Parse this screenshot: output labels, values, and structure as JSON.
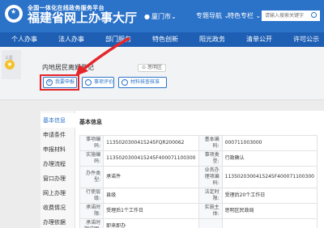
{
  "header": {
    "subtitle": "全国一体化在线政务服务平台",
    "title": "福建省网上办事大厅",
    "city": "厦门市",
    "links": [
      "专题导航",
      "特色专栏"
    ],
    "search_placeholder": "请输入搜索关键字",
    "brand_color": "#2b72c9"
  },
  "nav": {
    "items": [
      "个人办事",
      "法人办事",
      "部门服务",
      "特色创新",
      "阳光政务",
      "清单公开",
      "许可公示"
    ]
  },
  "service": {
    "badge": "三星",
    "title": "内地居民离婚登记",
    "location_tag": "思明区",
    "buttons": [
      "我要申报",
      "事项评价",
      "材料核查核准"
    ]
  },
  "sidebar": {
    "items": [
      "基本信息",
      "申请条件",
      "申报材料",
      "办理流程",
      "窗口办理",
      "网上办理",
      "收费情况",
      "办理依据"
    ],
    "active_index": 0
  },
  "basic_info": {
    "section_title": "基本信息",
    "rows": [
      [
        "事项编码:",
        "1135020300415245FQR200062",
        "基本编码:",
        "000711003000"
      ],
      [
        "实施编码:",
        "1135020300415245F400071100300",
        "事项类型:",
        "行政确认"
      ],
      [
        "办件类型:",
        "承诺件",
        "业务办理项编码:",
        "1135020300415245F400071100300"
      ],
      [
        "行使层级:",
        "县级",
        "法定时限:",
        "受理后20个工作日"
      ],
      [
        "承诺时限:",
        "受理后1个工作日",
        "实施主体:",
        "思明区民政局"
      ],
      [
        "承诺时限说明:",
        "即来即办",
        "",
        ""
      ]
    ]
  }
}
